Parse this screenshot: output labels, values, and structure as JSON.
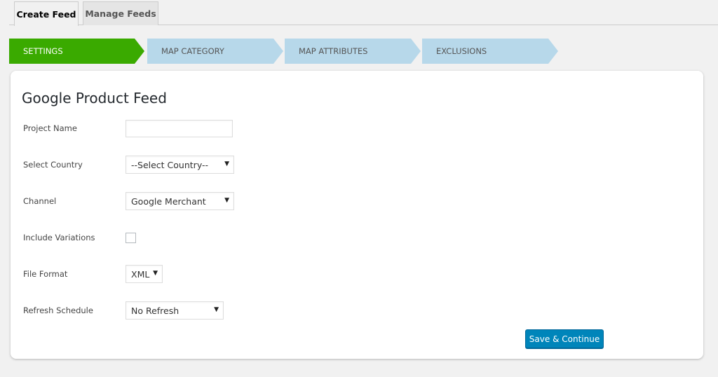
{
  "tabs": [
    {
      "label": "Create Feed",
      "active": true
    },
    {
      "label": "Manage Feeds",
      "active": false
    }
  ],
  "steps": [
    {
      "label": "SETTINGS",
      "active": true
    },
    {
      "label": "MAP CATEGORY",
      "active": false
    },
    {
      "label": "MAP ATTRIBUTES",
      "active": false
    },
    {
      "label": "EXCLUSIONS",
      "active": false
    }
  ],
  "colors": {
    "step_active": "#3aaa00",
    "step_inactive": "#b7d8ea",
    "primary_button": "#0085ba"
  },
  "form": {
    "title": "Google Product Feed",
    "project_name": {
      "label": "Project Name",
      "value": ""
    },
    "country": {
      "label": "Select Country",
      "value": "--Select Country--"
    },
    "channel": {
      "label": "Channel",
      "value": "Google Merchant"
    },
    "variations": {
      "label": "Include Variations",
      "checked": false
    },
    "file_format": {
      "label": "File Format",
      "value": "XML"
    },
    "refresh": {
      "label": "Refresh Schedule",
      "value": "No Refresh"
    },
    "caret_glyph": "▼",
    "submit_label": "Save & Continue"
  }
}
